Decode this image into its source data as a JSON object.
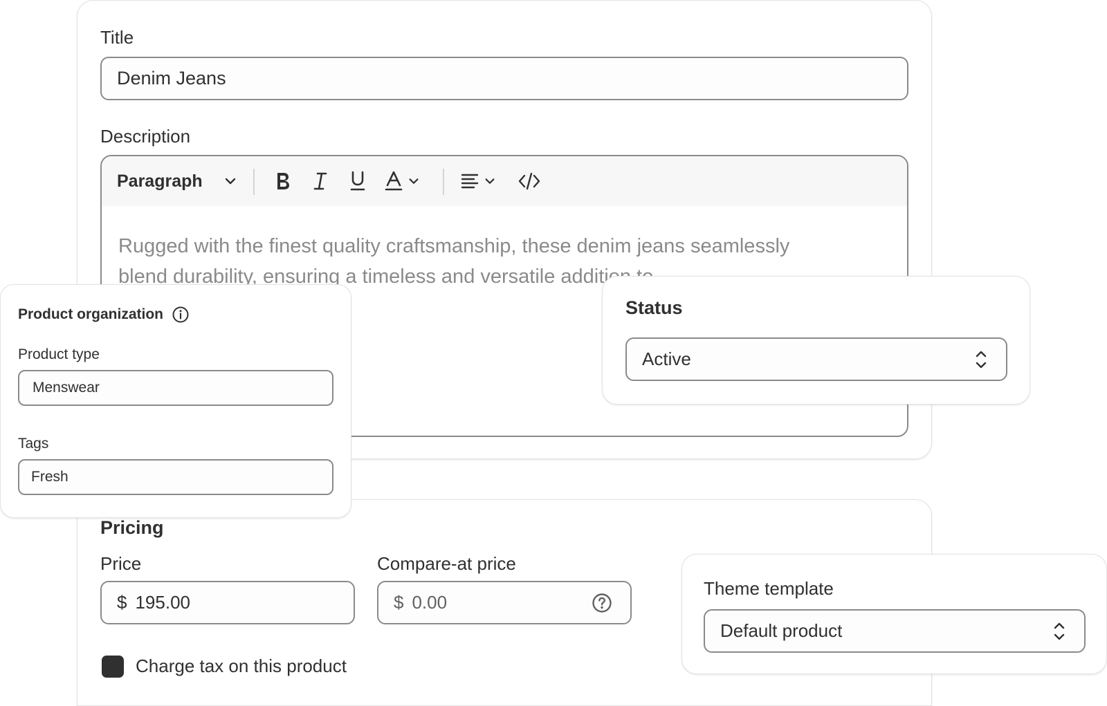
{
  "product": {
    "title_label": "Title",
    "title_value": "Denim Jeans",
    "description_label": "Description",
    "description_text": "Rugged with the finest quality craftsmanship, these denim jeans seamlessly blend durability, ensuring a timeless and versatile addition to",
    "toolbar": {
      "paragraph_label": "Paragraph",
      "icons": [
        "chevron-down-icon",
        "bold-icon",
        "italic-icon",
        "underline-icon",
        "text-color-icon",
        "align-icon",
        "code-icon"
      ]
    }
  },
  "organization": {
    "heading": "Product organization",
    "product_type_label": "Product type",
    "product_type_value": "Menswear",
    "tags_label": "Tags",
    "tags_value": "Fresh"
  },
  "status": {
    "heading": "Status",
    "value": "Active"
  },
  "pricing": {
    "heading": "Pricing",
    "price_label": "Price",
    "currency_symbol": "$",
    "price_value": "195.00",
    "compare_label": "Compare-at price",
    "compare_value": "0.00",
    "charge_tax_label": "Charge tax on this product",
    "charge_tax_checked": true
  },
  "theme": {
    "label": "Theme template",
    "value": "Default product"
  },
  "colors": {
    "text": "#303030",
    "muted_text": "#8a8a8a",
    "border": "#8a8a8a",
    "toolbar_bg": "#f7f7f7",
    "card_border": "#e3e3e3"
  }
}
